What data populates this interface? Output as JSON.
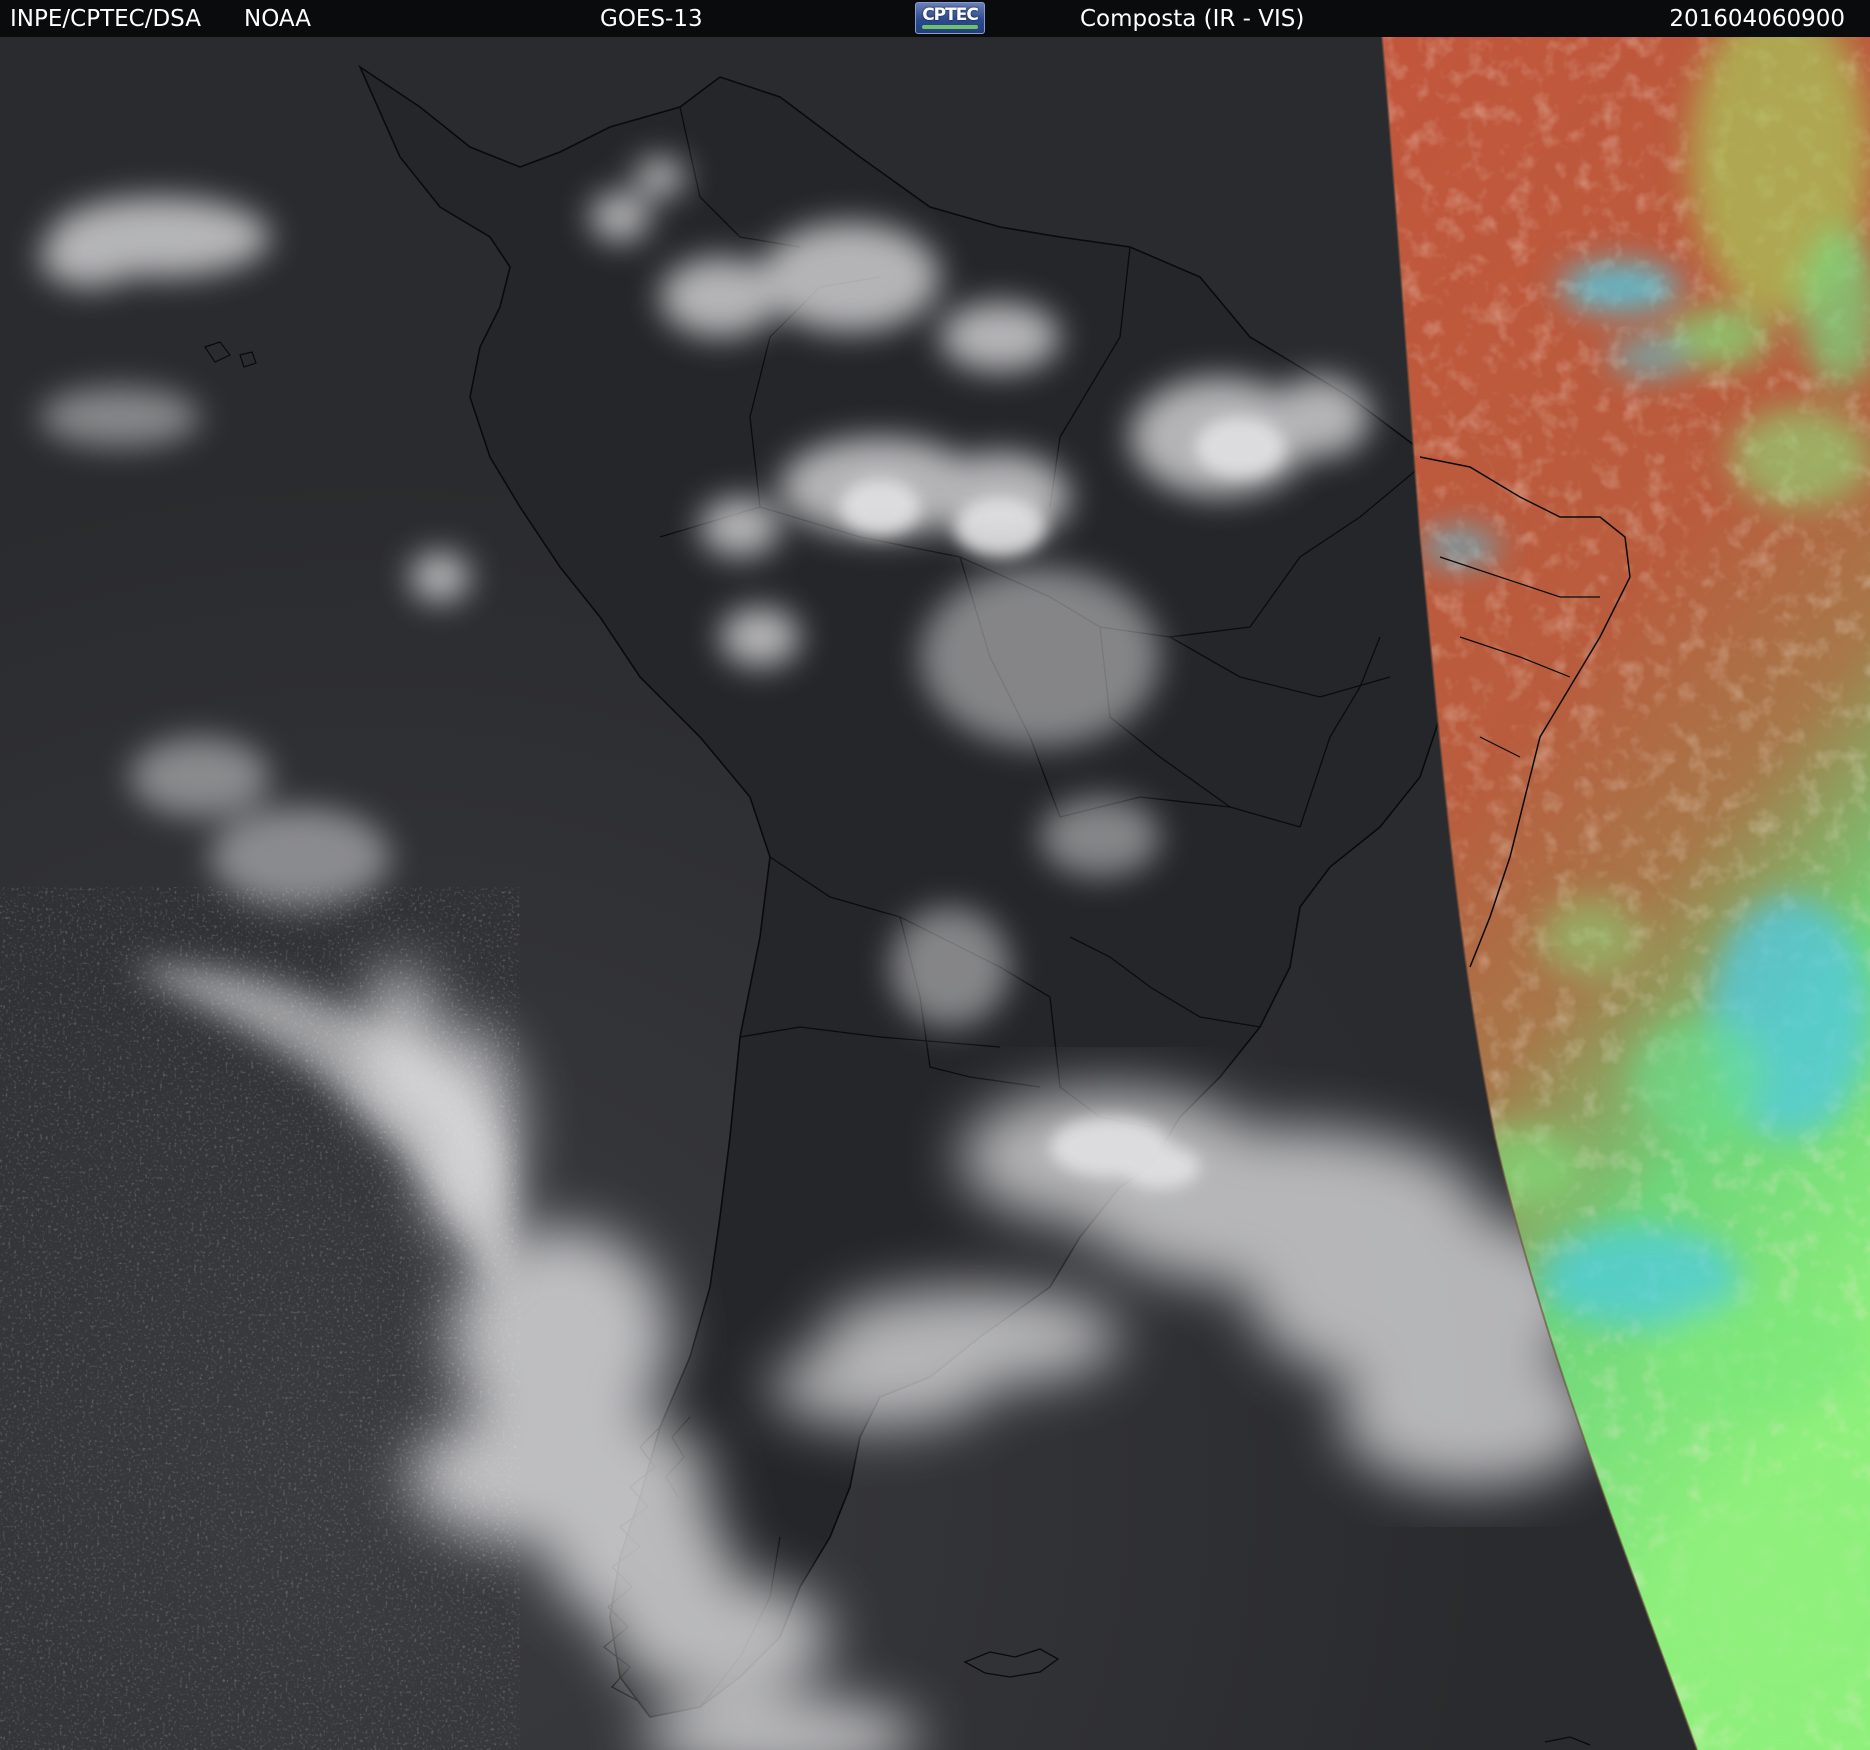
{
  "header": {
    "org": "INPE/CPTEC/DSA",
    "agency": "NOAA",
    "satellite": "GOES-13",
    "logo_text": "CPTEC",
    "product": "Composta (IR - VIS)",
    "timestamp": "201604060900"
  },
  "colors": {
    "header_bg": "#0a0b0d",
    "header_text": "#ffffff",
    "ocean_gray": "#2a2b2e",
    "cloud_white": "#e6e6e8",
    "vis_red": "#b95a3c",
    "vis_green": "#7fe07a",
    "vis_cyan": "#4fd0e6",
    "coastline": "#000000"
  }
}
